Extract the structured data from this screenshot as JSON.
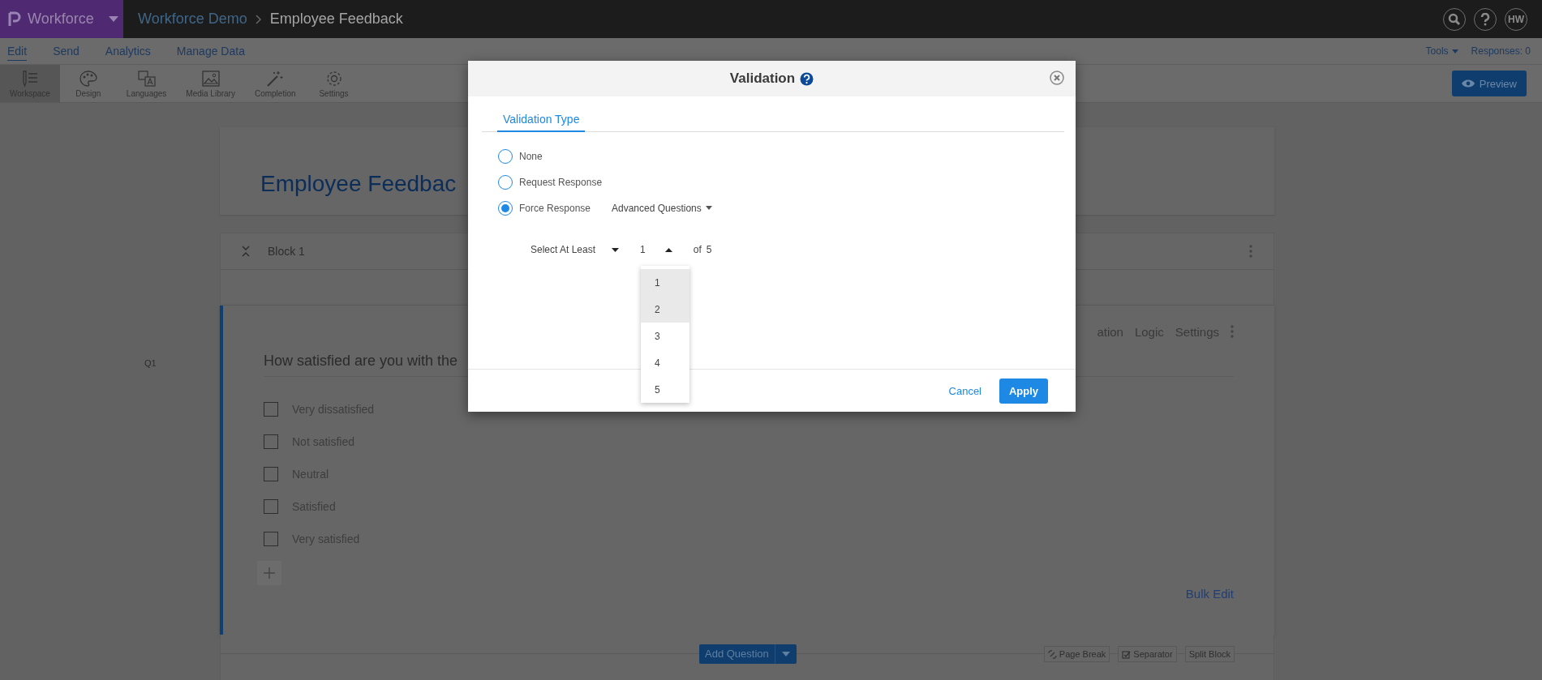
{
  "top_bar": {
    "product": "Workforce",
    "breadcrumbs": [
      "Workforce Demo",
      "Employee Feedback"
    ],
    "avatar": "HW"
  },
  "menu": [
    {
      "label": "Edit",
      "selected": true
    },
    {
      "label": "Send",
      "selected": false
    },
    {
      "label": "Analytics",
      "selected": false
    },
    {
      "label": "Manage Data",
      "selected": false
    }
  ],
  "menu_right": {
    "tools": "Tools",
    "responses": "Responses: 0"
  },
  "toolbar": [
    {
      "label": "Workspace",
      "kind": "workspace",
      "selected": true
    },
    {
      "label": "Design",
      "kind": "design",
      "selected": false
    },
    {
      "label": "Languages",
      "kind": "languages",
      "selected": false
    },
    {
      "label": "Media Library",
      "kind": "media",
      "selected": false
    },
    {
      "label": "Completion",
      "kind": "completion",
      "selected": false
    },
    {
      "label": "Settings",
      "kind": "settings",
      "selected": false
    }
  ],
  "preview_button": "Preview",
  "survey": {
    "title": "Employee Feedbac",
    "block_title": "Block 1",
    "question": {
      "number": "Q1",
      "text": "How satisfied are you with the",
      "actions": [
        "ation",
        "Logic",
        "Settings"
      ],
      "options": [
        {
          "label": "Very dissatisfied",
          "checked": false
        },
        {
          "label": "Not satisfied",
          "checked": false
        },
        {
          "label": "Neutral",
          "checked": false
        },
        {
          "label": "Satisfied",
          "checked": false
        },
        {
          "label": "Very satisfied",
          "checked": false
        }
      ],
      "bulk_edit": "Bulk Edit"
    },
    "add_question": "Add Question",
    "block_actions": [
      {
        "label": "Page Break",
        "kind": "page-break"
      },
      {
        "label": "Separator",
        "kind": "separator"
      },
      {
        "label": "Split Block",
        "kind": "plain"
      }
    ]
  },
  "dialog": {
    "title": "Validation",
    "tabs": [
      {
        "label": "Validation Type",
        "selected": true
      }
    ],
    "options": [
      {
        "label": "None",
        "selected": false
      },
      {
        "label": "Request Response",
        "selected": false
      },
      {
        "label": "Force Response",
        "selected": true,
        "menu": "Advanced Questions"
      }
    ],
    "select_label": "Select At Least",
    "select_value": "1",
    "of_label": "of",
    "of_total": "5",
    "dropdown": [
      {
        "label": "1",
        "highlighted": true
      },
      {
        "label": "2",
        "highlighted": true
      },
      {
        "label": "3",
        "highlighted": false
      },
      {
        "label": "4",
        "highlighted": false
      },
      {
        "label": "5",
        "highlighted": false
      }
    ],
    "cancel": "Cancel",
    "apply": "Apply"
  }
}
